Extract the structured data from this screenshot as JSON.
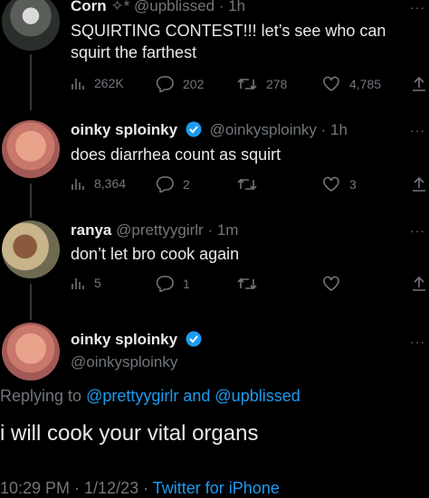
{
  "tweets": [
    {
      "name": "Corn",
      "name_suffix": "✧*",
      "handle": "@upblissed",
      "time": "1h",
      "text_line1": "SQUIRTING CONTEST!!! let’s see who can",
      "text_line2": "squirt the farthest",
      "views": "262K",
      "replies": "202",
      "retweets": "278",
      "likes": "4,785"
    },
    {
      "name": "oinky sploinky",
      "handle": "@oinkysploinky",
      "time": "1h",
      "text": "does diarrhea count as squirt",
      "views": "8,364",
      "replies": "2",
      "retweets": "",
      "likes": "3"
    },
    {
      "name": "ranya",
      "handle": "@prettyygirlr",
      "time": "1m",
      "text": "don’t let bro cook again",
      "views": "5",
      "replies": "1",
      "retweets": "",
      "likes": ""
    }
  ],
  "focused": {
    "name": "oinky sploinky",
    "handle": "@oinkysploinky",
    "replying_prefix": "Replying to ",
    "reply_user1": "@prettyygirlr",
    "reply_and": " and ",
    "reply_user2": "@upblissed",
    "text": "i will cook your vital organs",
    "time": "10:29 PM",
    "sep1": " · ",
    "date": "1/12/23",
    "sep2": " · ",
    "client": "Twitter for iPhone"
  },
  "colors": {
    "link": "#1d9bf0",
    "muted": "#71767b",
    "background": "#000000",
    "verified": "#1d9bf0"
  },
  "icons": [
    "views-icon",
    "reply-icon",
    "retweet-icon",
    "like-icon",
    "share-icon",
    "more-icon",
    "verified-badge-icon"
  ]
}
